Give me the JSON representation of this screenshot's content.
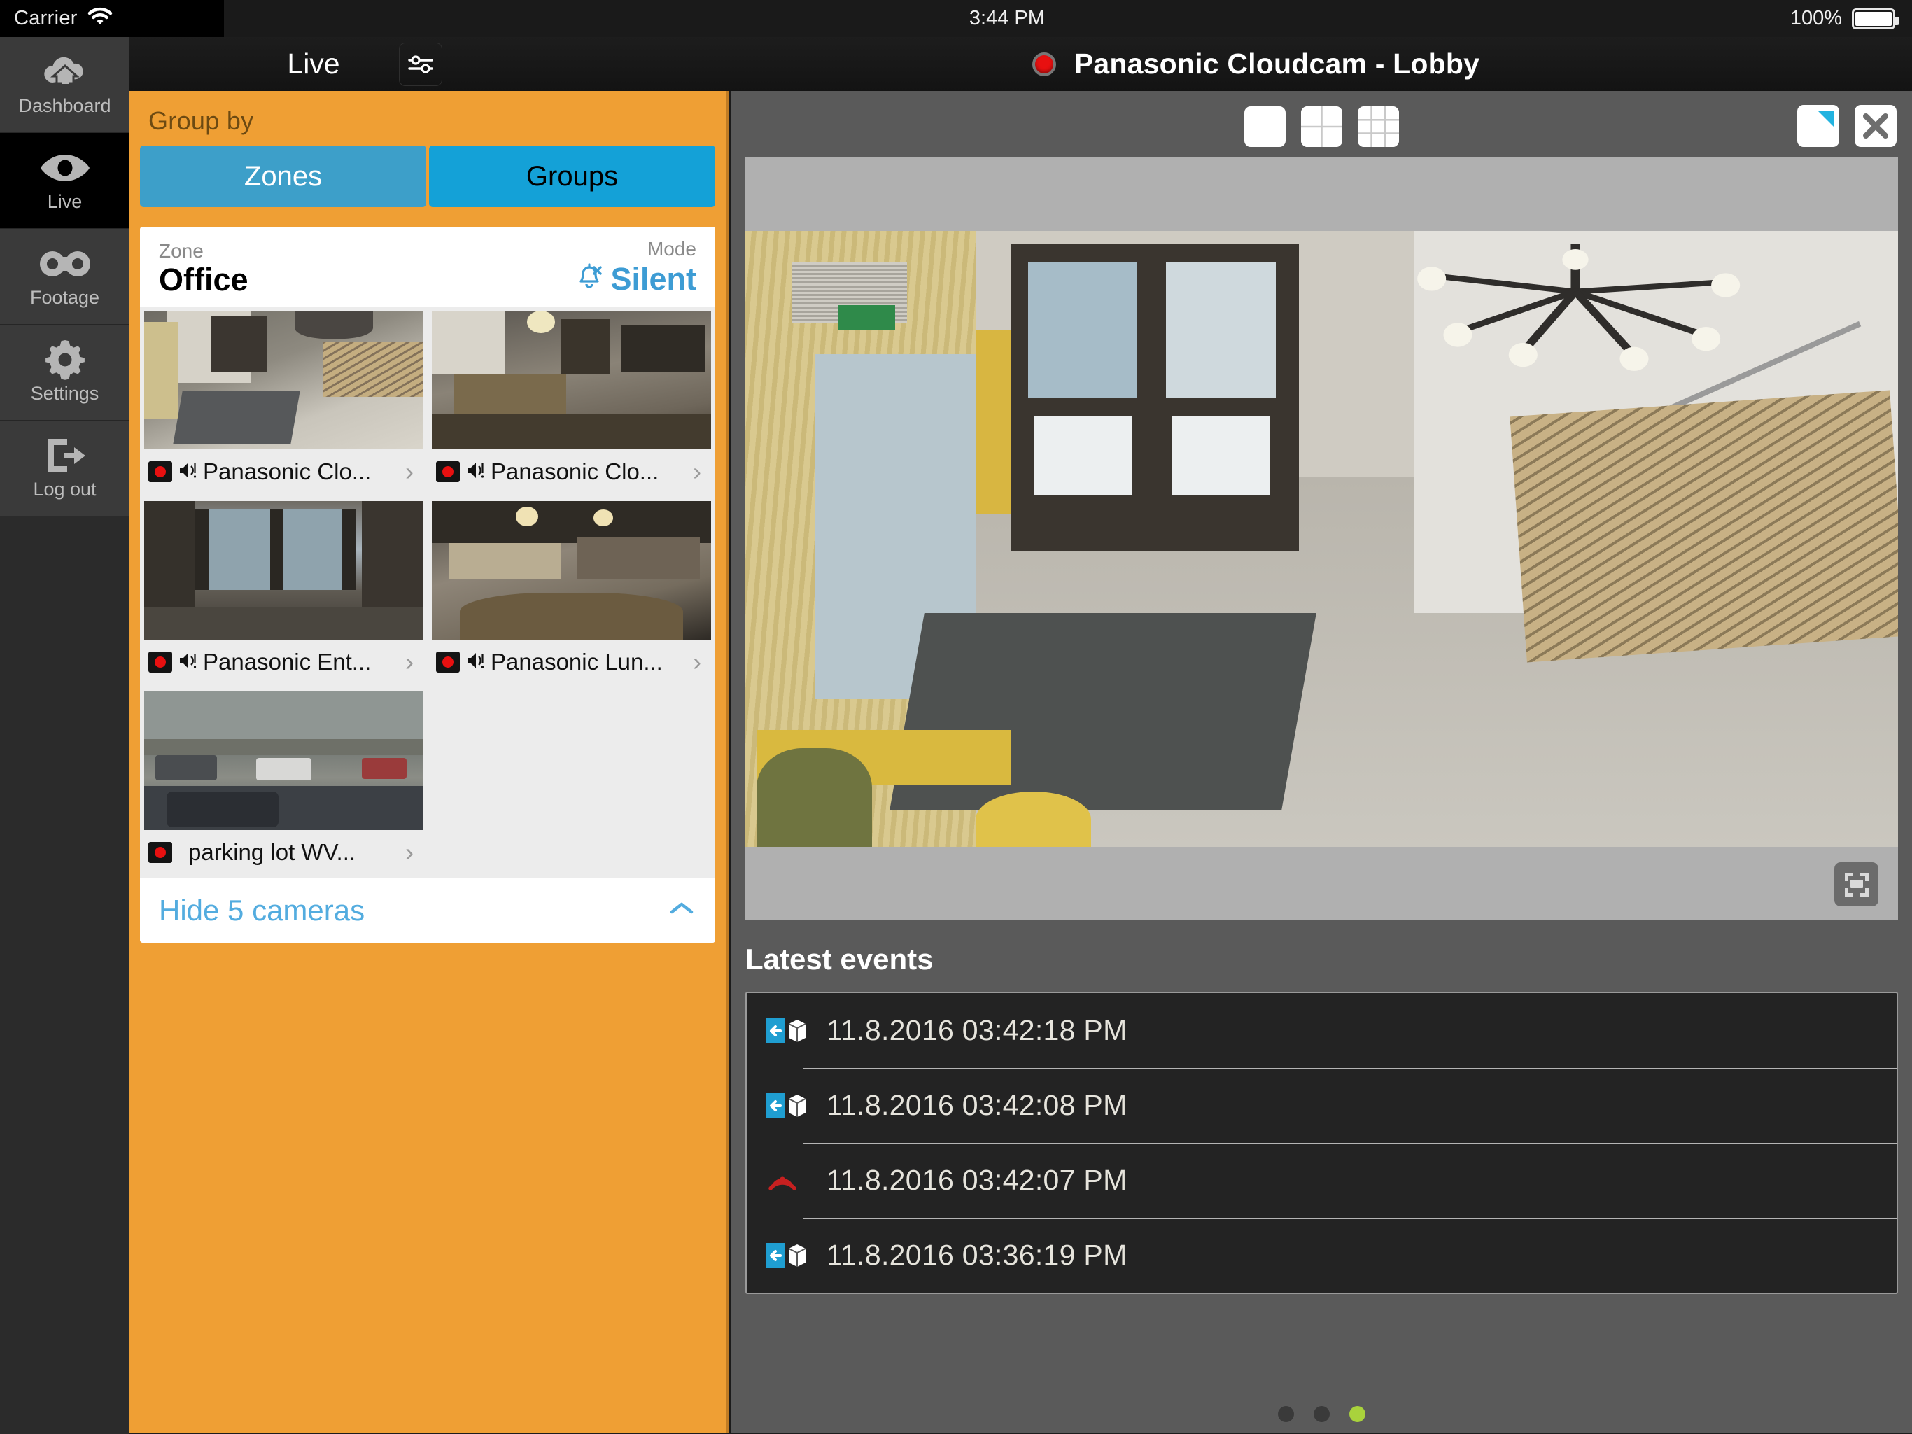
{
  "status_bar": {
    "carrier": "Carrier",
    "wifi_icon": "wifi-icon",
    "time": "3:44 PM",
    "battery_percent": "100%",
    "battery_icon": "battery-full-icon"
  },
  "sidebar": {
    "items": [
      {
        "label": "Dashboard",
        "icon": "cloud-home-icon",
        "active": false
      },
      {
        "label": "Live",
        "icon": "eye-icon",
        "active": true
      },
      {
        "label": "Footage",
        "icon": "binoculars-icon",
        "active": false
      },
      {
        "label": "Settings",
        "icon": "gear-icon",
        "active": false
      },
      {
        "label": "Log out",
        "icon": "logout-icon",
        "active": false
      }
    ]
  },
  "header": {
    "title": "Live",
    "filter_icon": "sliders-icon",
    "record_indicator": "record-dot-icon",
    "camera_title": "Panasonic Cloudcam - Lobby"
  },
  "group_panel": {
    "group_by_label": "Group by",
    "segments": [
      {
        "label": "Zones",
        "active": false
      },
      {
        "label": "Groups",
        "active": true
      }
    ],
    "zone_card": {
      "zone_caption": "Zone",
      "zone_name": "Office",
      "mode_caption": "Mode",
      "mode_value": "Silent",
      "mode_icon": "bell-off-icon",
      "cameras": [
        {
          "name": "Panasonic Clo...",
          "has_audio": true,
          "recording": true,
          "chevron": "›"
        },
        {
          "name": "Panasonic Clo...",
          "has_audio": true,
          "recording": true,
          "chevron": "›"
        },
        {
          "name": "Panasonic Ent...",
          "has_audio": true,
          "recording": true,
          "chevron": "›"
        },
        {
          "name": "Panasonic Lun...",
          "has_audio": true,
          "recording": true,
          "chevron": "›"
        },
        {
          "name": "parking lot WV...",
          "has_audio": false,
          "recording": true,
          "chevron": "›"
        }
      ],
      "hide_label": "Hide 5 cameras",
      "hide_chevron": "chevron-up-icon"
    }
  },
  "video_panel": {
    "layout_buttons": [
      {
        "name": "layout-1x1",
        "cells": 1
      },
      {
        "name": "layout-2x2",
        "cells": 4
      },
      {
        "name": "layout-3x3",
        "cells": 9
      }
    ],
    "corner_button_icon": "picture-in-picture-icon",
    "close_button_icon": "close-icon",
    "fullscreen_button_icon": "fullscreen-icon",
    "events": {
      "title": "Latest events",
      "rows": [
        {
          "timestamp": "11.8.2016 03:42:18 PM",
          "icon": "motion-in-icon"
        },
        {
          "timestamp": "11.8.2016 03:42:08 PM",
          "icon": "motion-in-icon"
        },
        {
          "timestamp": "11.8.2016 03:42:07 PM",
          "icon": "connection-lost-icon"
        },
        {
          "timestamp": "11.8.2016 03:36:19 PM",
          "icon": "motion-in-icon"
        }
      ]
    },
    "page_dots": {
      "count": 3,
      "active_index": 2,
      "active_color": "#a9d23c"
    }
  },
  "colors": {
    "orange_panel": "#ef9f34",
    "segment_active": "#14a1d7",
    "segment_inactive": "#3d9fc9",
    "accent_blue": "#3d9cd4",
    "record_red": "#e81010",
    "dot_green": "#a9d23c"
  }
}
